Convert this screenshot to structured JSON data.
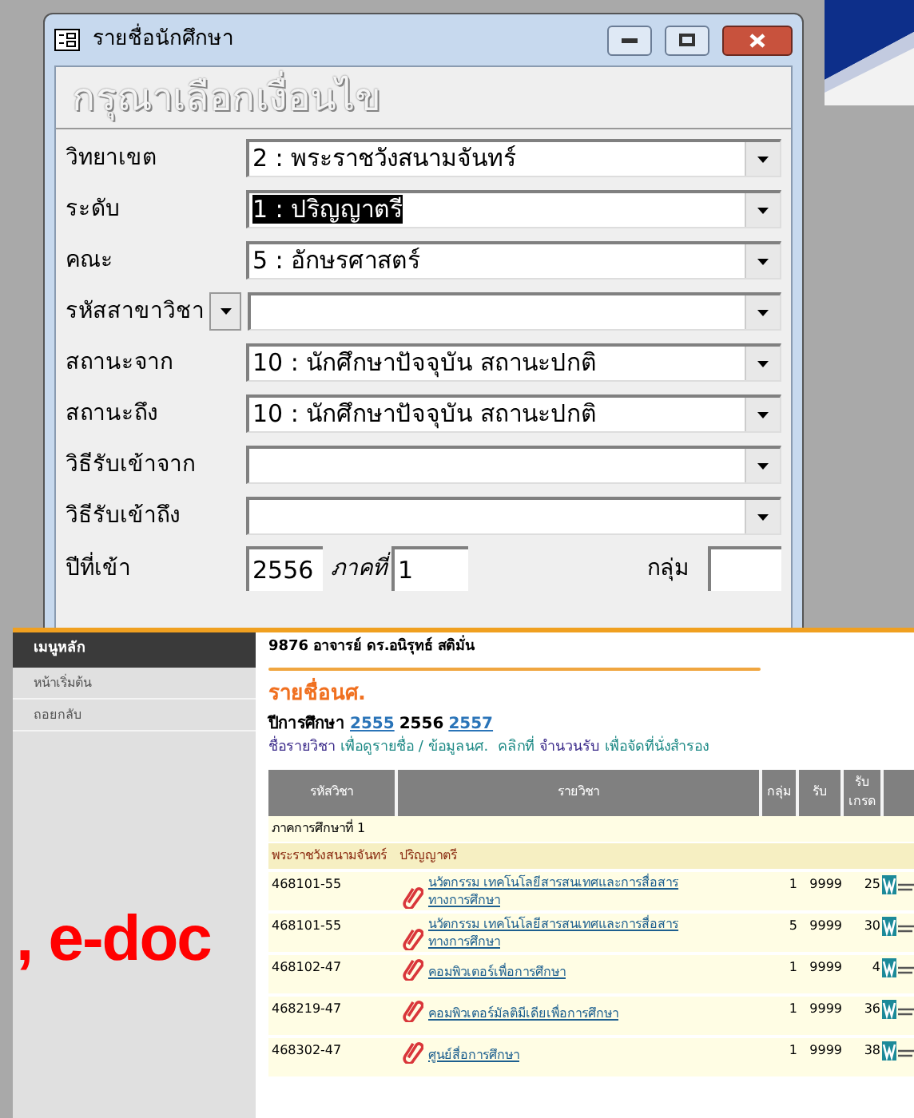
{
  "dialog": {
    "title": "รายชื่อนักศึกษา",
    "heading": "กรุณาเลือกเงื่อนไข",
    "fields": [
      {
        "kind": "combo",
        "label": "วิทยาเขต",
        "value": "2 : พระราชวังสนามจันทร์",
        "highlighted": false
      },
      {
        "kind": "combo",
        "label": "ระดับ",
        "value": "1 : ปริญญาตรี",
        "highlighted": true
      },
      {
        "kind": "combo",
        "label": "คณะ",
        "value": "5 : อักษรศาสตร์",
        "highlighted": false
      },
      {
        "kind": "label_dropdown",
        "label": "รหัสสาขาวิชา"
      },
      {
        "kind": "combo",
        "label": "สถานะจาก",
        "value": "10 : นักศึกษาปัจจุบัน สถานะปกติ",
        "highlighted": false
      },
      {
        "kind": "combo",
        "label": "สถานะถึง",
        "value": "10 : นักศึกษาปัจจุบัน สถานะปกติ",
        "highlighted": false
      },
      {
        "kind": "combo",
        "label": "วิธีรับเข้าจาก"
      },
      {
        "kind": "combo",
        "label": "วิธีรับเข้าถึง"
      }
    ],
    "year_label": "ปีที่เข้า",
    "year": "2556",
    "term_label": "ภาคที่",
    "term": "1",
    "group_label": "กลุ่ม"
  },
  "web": {
    "sidebar": {
      "header": "เมนูหลัก",
      "items": [
        {
          "label": "หน้าเริ่มต้น",
          "selected": false
        },
        {
          "label": "ถอยกลับ",
          "selected": false
        }
      ]
    },
    "user": "9876 อาจารย์ ดร.อนิรุทธ์ สติมั่น",
    "title": "รายชื่อนศ.",
    "year_label": "ปีการศึกษา",
    "years": [
      {
        "text": "2555",
        "selected": false
      },
      {
        "text": "2556",
        "selected": true
      },
      {
        "text": "2557",
        "selected": false
      }
    ],
    "hint": [
      {
        "text": "ชื่อรายวิชา",
        "kind": "keyword"
      },
      {
        "text": "เพื่อดูรายชื่อ / ข้อมูลนศ.  คลิกที่",
        "kind": "plain"
      },
      {
        "text": "จำนวนรับ",
        "kind": "keyword"
      },
      {
        "text": "เพื่อจัดที่นั่งสำรอง",
        "kind": "plain"
      }
    ],
    "table": {
      "columns": [
        "รหัสวิชา",
        "รายวิชา",
        "กลุ่ม",
        "รับ",
        "รับเกรด"
      ],
      "semester": "ภาคการศึกษาที่ 1",
      "campus": "พระราชวังสนามจันทร์",
      "level": "ปริญญาตรี",
      "rows": [
        {
          "code": "468101-55",
          "course": "นวัตกรรม เทคโนโลยีสารสนเทศและการสื่อสารทางการศึกษา",
          "group": "1",
          "quota": "9999",
          "grade_quota": "25"
        },
        {
          "code": "468101-55",
          "course": "นวัตกรรม เทคโนโลยีสารสนเทศและการสื่อสารทางการศึกษา",
          "group": "5",
          "quota": "9999",
          "grade_quota": "30"
        },
        {
          "code": "468102-47",
          "course": "คอมพิวเตอร์เพื่อการศึกษา",
          "group": "1",
          "quota": "9999",
          "grade_quota": "4"
        },
        {
          "code": "468219-47",
          "course": "คอมพิวเตอร์มัลติมีเดียเพื่อการศึกษา",
          "group": "1",
          "quota": "9999",
          "grade_quota": "36"
        },
        {
          "code": "468302-47",
          "course": "ศูนย์สื่อการศึกษา",
          "group": "1",
          "quota": "9999",
          "grade_quota": "38"
        }
      ]
    }
  },
  "overlay": ", e-doc"
}
